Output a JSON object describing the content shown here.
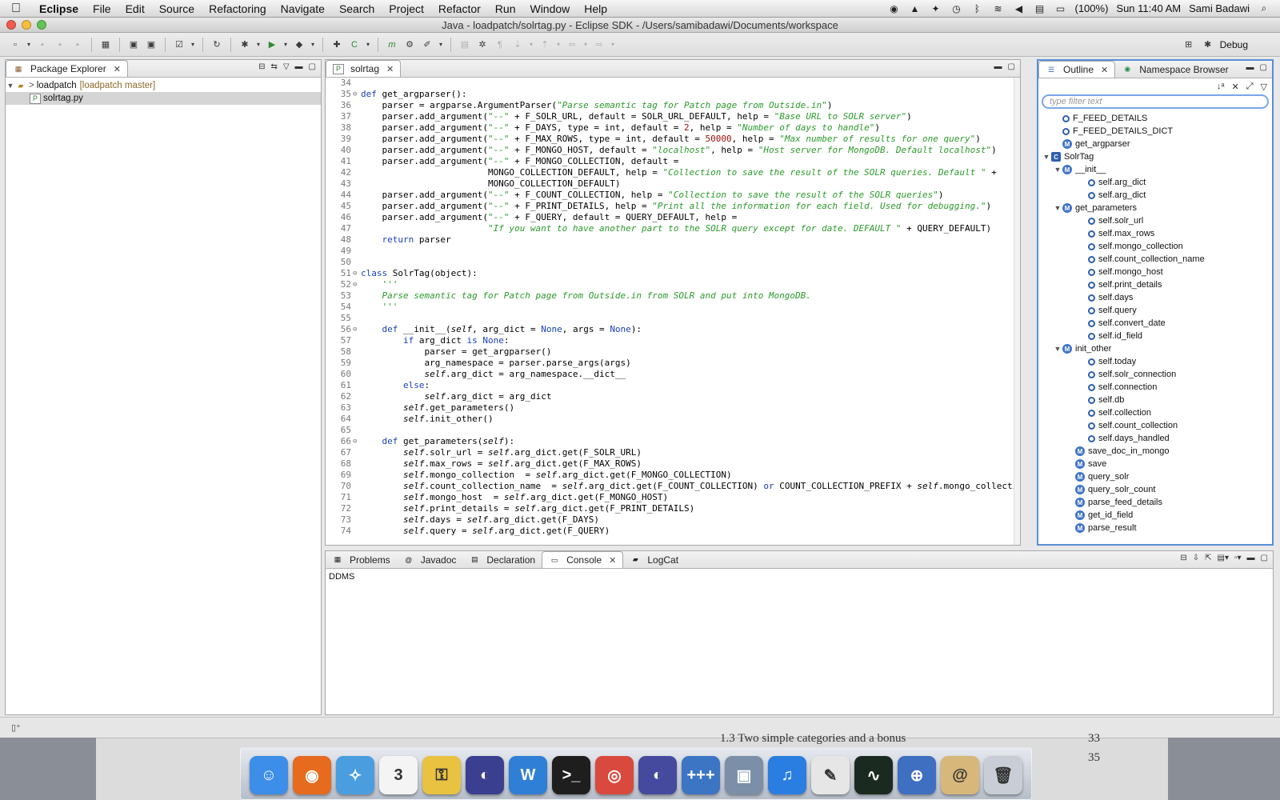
{
  "menubar": {
    "app": "Eclipse",
    "items": [
      "File",
      "Edit",
      "Source",
      "Refactoring",
      "Navigate",
      "Search",
      "Project",
      "Refactor",
      "Run",
      "Window",
      "Help"
    ],
    "battery": "(100%)",
    "clock": "Sun 11:40 AM",
    "user": "Sami Badawi"
  },
  "window": {
    "title": "Java - loadpatch/solrtag.py - Eclipse SDK - /Users/samibadawi/Documents/workspace",
    "perspective": "Debug"
  },
  "package_explorer": {
    "tab": "Package Explorer",
    "project": "loadpatch",
    "project_branch": "[loadpatch master]",
    "file": "solrtag.py"
  },
  "editor": {
    "tab": "solrtag",
    "lines": [
      {
        "n": "34",
        "fold": "",
        "t": ""
      },
      {
        "n": "35",
        "fold": "⊖",
        "t": "def get_argparser():"
      },
      {
        "n": "36",
        "fold": "",
        "t": "    parser = argparse.ArgumentParser(\"Parse semantic tag for Patch page from Outside.in\")"
      },
      {
        "n": "37",
        "fold": "",
        "t": "    parser.add_argument(\"--\" + F_SOLR_URL, default = SOLR_URL_DEFAULT, help = \"Base URL to SOLR server\")"
      },
      {
        "n": "38",
        "fold": "",
        "t": "    parser.add_argument(\"--\" + F_DAYS, type = int, default = 2, help = \"Number of days to handle\")"
      },
      {
        "n": "39",
        "fold": "",
        "t": "    parser.add_argument(\"--\" + F_MAX_ROWS, type = int, default = 50000, help = \"Max number of results for one query\")"
      },
      {
        "n": "40",
        "fold": "",
        "t": "    parser.add_argument(\"--\" + F_MONGO_HOST, default = \"localhost\", help = \"Host server for MongoDB. Default localhost\")"
      },
      {
        "n": "41",
        "fold": "",
        "t": "    parser.add_argument(\"--\" + F_MONGO_COLLECTION, default ="
      },
      {
        "n": "42",
        "fold": "",
        "t": "                        MONGO_COLLECTION_DEFAULT, help = \"Collection to save the result of the SOLR queries. Default \" +"
      },
      {
        "n": "43",
        "fold": "",
        "t": "                        MONGO_COLLECTION_DEFAULT)"
      },
      {
        "n": "44",
        "fold": "",
        "t": "    parser.add_argument(\"--\" + F_COUNT_COLLECTION, help = \"Collection to save the result of the SOLR queries\")"
      },
      {
        "n": "45",
        "fold": "",
        "t": "    parser.add_argument(\"--\" + F_PRINT_DETAILS, help = \"Print all the information for each field. Used for debugging.\")"
      },
      {
        "n": "46",
        "fold": "",
        "t": "    parser.add_argument(\"--\" + F_QUERY, default = QUERY_DEFAULT, help ="
      },
      {
        "n": "47",
        "fold": "",
        "t": "                        \"If you want to have another part to the SOLR query except for date. DEFAULT \" + QUERY_DEFAULT)"
      },
      {
        "n": "48",
        "fold": "",
        "t": "    return parser"
      },
      {
        "n": "49",
        "fold": "",
        "t": ""
      },
      {
        "n": "50",
        "fold": "",
        "t": ""
      },
      {
        "n": "51",
        "fold": "⊖",
        "t": "class SolrTag(object):"
      },
      {
        "n": "52",
        "fold": "⊖",
        "t": "    '''"
      },
      {
        "n": "53",
        "fold": "",
        "t": "    Parse semantic tag for Patch page from Outside.in from SOLR and put into MongoDB."
      },
      {
        "n": "54",
        "fold": "",
        "t": "    '''"
      },
      {
        "n": "55",
        "fold": "",
        "t": ""
      },
      {
        "n": "56",
        "fold": "⊖",
        "t": "    def __init__(self, arg_dict = None, args = None):"
      },
      {
        "n": "57",
        "fold": "",
        "t": "        if arg_dict is None:"
      },
      {
        "n": "58",
        "fold": "",
        "t": "            parser = get_argparser()"
      },
      {
        "n": "59",
        "fold": "",
        "t": "            arg_namespace = parser.parse_args(args)"
      },
      {
        "n": "60",
        "fold": "",
        "t": "            self.arg_dict = arg_namespace.__dict__"
      },
      {
        "n": "61",
        "fold": "",
        "t": "        else:"
      },
      {
        "n": "62",
        "fold": "",
        "t": "            self.arg_dict = arg_dict"
      },
      {
        "n": "63",
        "fold": "",
        "t": "        self.get_parameters()"
      },
      {
        "n": "64",
        "fold": "",
        "t": "        self.init_other()"
      },
      {
        "n": "65",
        "fold": "",
        "t": ""
      },
      {
        "n": "66",
        "fold": "⊖",
        "t": "    def get_parameters(self):"
      },
      {
        "n": "67",
        "fold": "",
        "t": "        self.solr_url = self.arg_dict.get(F_SOLR_URL)"
      },
      {
        "n": "68",
        "fold": "",
        "t": "        self.max_rows = self.arg_dict.get(F_MAX_ROWS)"
      },
      {
        "n": "69",
        "fold": "",
        "t": "        self.mongo_collection  = self.arg_dict.get(F_MONGO_COLLECTION)"
      },
      {
        "n": "70",
        "fold": "",
        "t": "        self.count_collection_name  = self.arg_dict.get(F_COUNT_COLLECTION) or COUNT_COLLECTION_PREFIX + self.mongo_collectio"
      },
      {
        "n": "71",
        "fold": "",
        "t": "        self.mongo_host  = self.arg_dict.get(F_MONGO_HOST)"
      },
      {
        "n": "72",
        "fold": "",
        "t": "        self.print_details = self.arg_dict.get(F_PRINT_DETAILS)"
      },
      {
        "n": "73",
        "fold": "",
        "t": "        self.days = self.arg_dict.get(F_DAYS)"
      },
      {
        "n": "74",
        "fold": "",
        "t": "        self.query = self.arg_dict.get(F_QUERY)"
      }
    ]
  },
  "outline": {
    "tabs": [
      "Outline",
      "Namespace Browser"
    ],
    "filter_placeholder": "type filter text",
    "items": [
      {
        "label": "F_FEED_DETAILS",
        "kind": "attr",
        "depth": 1,
        "toggle": ""
      },
      {
        "label": "F_FEED_DETAILS_DICT",
        "kind": "attr",
        "depth": 1,
        "toggle": ""
      },
      {
        "label": "get_argparser",
        "kind": "method",
        "depth": 1,
        "toggle": ""
      },
      {
        "label": "SolrTag",
        "kind": "class",
        "depth": 0,
        "toggle": "▼"
      },
      {
        "label": "__init__",
        "kind": "method",
        "depth": 1,
        "toggle": "▼"
      },
      {
        "label": "self.arg_dict",
        "kind": "attr",
        "depth": 3,
        "toggle": ""
      },
      {
        "label": "self.arg_dict",
        "kind": "attr",
        "depth": 3,
        "toggle": ""
      },
      {
        "label": "get_parameters",
        "kind": "method",
        "depth": 1,
        "toggle": "▼"
      },
      {
        "label": "self.solr_url",
        "kind": "attr",
        "depth": 3,
        "toggle": ""
      },
      {
        "label": "self.max_rows",
        "kind": "attr",
        "depth": 3,
        "toggle": ""
      },
      {
        "label": "self.mongo_collection",
        "kind": "attr",
        "depth": 3,
        "toggle": ""
      },
      {
        "label": "self.count_collection_name",
        "kind": "attr",
        "depth": 3,
        "toggle": ""
      },
      {
        "label": "self.mongo_host",
        "kind": "attr",
        "depth": 3,
        "toggle": ""
      },
      {
        "label": "self.print_details",
        "kind": "attr",
        "depth": 3,
        "toggle": ""
      },
      {
        "label": "self.days",
        "kind": "attr",
        "depth": 3,
        "toggle": ""
      },
      {
        "label": "self.query",
        "kind": "attr",
        "depth": 3,
        "toggle": ""
      },
      {
        "label": "self.convert_date",
        "kind": "attr",
        "depth": 3,
        "toggle": ""
      },
      {
        "label": "self.id_field",
        "kind": "attr",
        "depth": 3,
        "toggle": ""
      },
      {
        "label": "init_other",
        "kind": "method",
        "depth": 1,
        "toggle": "▼"
      },
      {
        "label": "self.today",
        "kind": "attr",
        "depth": 3,
        "toggle": ""
      },
      {
        "label": "self.solr_connection",
        "kind": "attr",
        "depth": 3,
        "toggle": ""
      },
      {
        "label": "self.connection",
        "kind": "attr",
        "depth": 3,
        "toggle": ""
      },
      {
        "label": "self.db",
        "kind": "attr",
        "depth": 3,
        "toggle": ""
      },
      {
        "label": "self.collection",
        "kind": "attr",
        "depth": 3,
        "toggle": ""
      },
      {
        "label": "self.count_collection",
        "kind": "attr",
        "depth": 3,
        "toggle": ""
      },
      {
        "label": "self.days_handled",
        "kind": "attr",
        "depth": 3,
        "toggle": ""
      },
      {
        "label": "save_doc_in_mongo",
        "kind": "method",
        "depth": 2,
        "toggle": ""
      },
      {
        "label": "save",
        "kind": "method",
        "depth": 2,
        "toggle": ""
      },
      {
        "label": "query_solr",
        "kind": "method",
        "depth": 2,
        "toggle": ""
      },
      {
        "label": "query_solr_count",
        "kind": "method",
        "depth": 2,
        "toggle": ""
      },
      {
        "label": "parse_feed_details",
        "kind": "method",
        "depth": 2,
        "toggle": ""
      },
      {
        "label": "get_id_field",
        "kind": "method",
        "depth": 2,
        "toggle": ""
      },
      {
        "label": "parse_result",
        "kind": "method",
        "depth": 2,
        "toggle": ""
      }
    ]
  },
  "console": {
    "tabs": [
      "Problems",
      "Javadoc",
      "Declaration",
      "Console",
      "LogCat"
    ],
    "active_tab": "Console",
    "header": "DDMS"
  },
  "background_document": {
    "line": "1.3     Two simple categories and a bonus",
    "numbers": [
      "33",
      "35"
    ]
  },
  "dock": {
    "apps": [
      {
        "icon": "finder-icon",
        "color": "#3d8ee8",
        "glyph": "☺"
      },
      {
        "icon": "firefox-icon",
        "color": "#e66b1f",
        "glyph": "◉"
      },
      {
        "icon": "safari-icon",
        "color": "#4a9ee0",
        "glyph": "✧"
      },
      {
        "icon": "calendar-icon",
        "color": "#f4f4f4",
        "glyph": "3"
      },
      {
        "icon": "keychain-icon",
        "color": "#e8c240",
        "glyph": "⚿"
      },
      {
        "icon": "eclipse-icon",
        "color": "#3b3f8f",
        "glyph": "◐"
      },
      {
        "icon": "word-icon",
        "color": "#2f7fd6",
        "glyph": "W"
      },
      {
        "icon": "terminal-icon",
        "color": "#1e1e1e",
        "glyph": ">_"
      },
      {
        "icon": "chrome-icon",
        "color": "#d9493d",
        "glyph": "◎"
      },
      {
        "icon": "eclipse-alt-icon",
        "color": "#464a9e",
        "glyph": "◐"
      },
      {
        "icon": "cpp-editor-icon",
        "color": "#3b75c4",
        "glyph": "+++"
      },
      {
        "icon": "preview-icon",
        "color": "#7b8fa8",
        "glyph": "▣"
      },
      {
        "icon": "itunes-icon",
        "color": "#2a7de1",
        "glyph": "♫"
      },
      {
        "icon": "textedit-icon",
        "color": "#e6e6e6",
        "glyph": "✎"
      },
      {
        "icon": "activity-monitor-icon",
        "color": "#1b2a20",
        "glyph": "∿"
      },
      {
        "icon": "network-utility-icon",
        "color": "#3f6fc0",
        "glyph": "⊕"
      },
      {
        "icon": "address-book-icon",
        "color": "#d8b77a",
        "glyph": "@"
      },
      {
        "icon": "trash-icon",
        "color": "#c9ced6",
        "glyph": "🗑"
      }
    ]
  }
}
